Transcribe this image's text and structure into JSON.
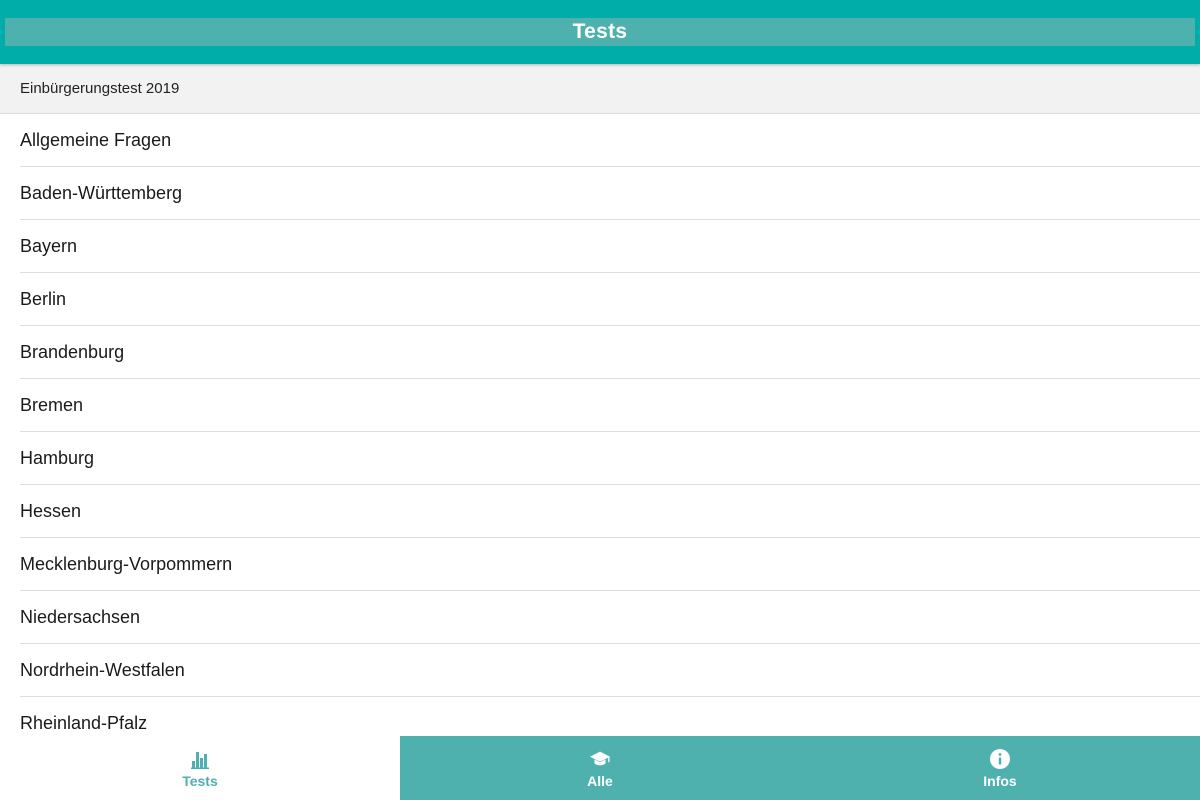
{
  "header": {
    "title": "Tests"
  },
  "section": {
    "title": "Einbürgerungstest 2019"
  },
  "list": {
    "items": [
      "Allgemeine Fragen",
      "Baden-Württemberg",
      "Bayern",
      "Berlin",
      "Brandenburg",
      "Bremen",
      "Hamburg",
      "Hessen",
      "Mecklenburg-Vorpommern",
      "Niedersachsen",
      "Nordrhein-Westfalen",
      "Rheinland-Pfalz"
    ]
  },
  "tabs": [
    {
      "label": "Tests",
      "icon": "bar-chart-icon",
      "active": true
    },
    {
      "label": "Alle",
      "icon": "graduation-cap-icon",
      "active": false
    },
    {
      "label": "Infos",
      "icon": "info-icon",
      "active": false
    }
  ],
  "colors": {
    "primary": "#00ada9",
    "accent": "#4eb1ae",
    "section_bg": "#f2f2f2"
  }
}
